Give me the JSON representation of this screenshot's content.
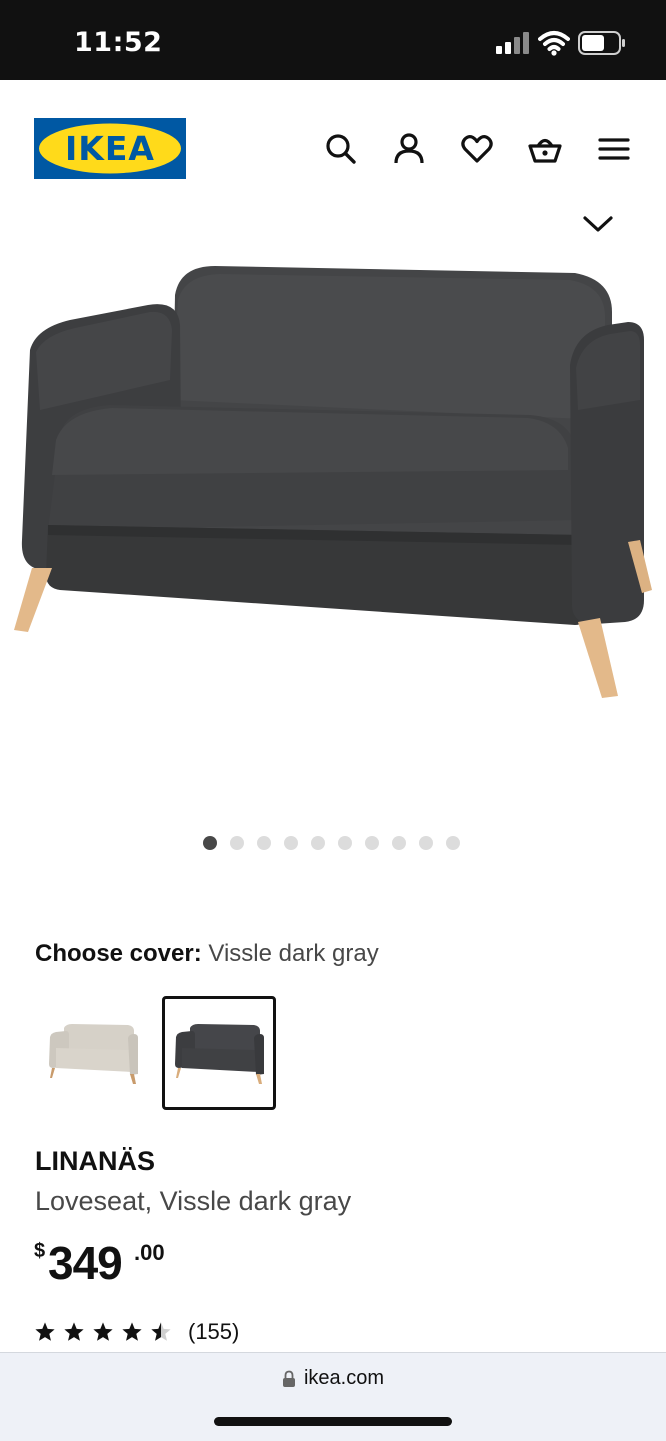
{
  "status_bar": {
    "time": "11:52"
  },
  "header": {
    "logo_text": "IKEA",
    "icons": [
      "search-icon",
      "account-icon",
      "heart-icon",
      "basket-icon",
      "menu-icon"
    ]
  },
  "gallery": {
    "image_count": 10,
    "active_index": 0
  },
  "cover": {
    "label": "Choose cover:",
    "selected_value": "Vissle dark gray",
    "options": [
      {
        "color": "#d6d1c8",
        "selected": false
      },
      {
        "color": "#3e3f41",
        "selected": true
      }
    ]
  },
  "product": {
    "name": "LINANÄS",
    "description": "Loveseat, Vissle dark gray",
    "price": {
      "currency": "$",
      "whole": "349",
      "cents": ".00"
    },
    "rating": {
      "value": 4.5,
      "max": 5,
      "count": "(155)"
    }
  },
  "browser": {
    "url": "ikea.com"
  },
  "colors": {
    "ikea_blue": "#0058a3",
    "ikea_yellow": "#ffda1a",
    "sofa": "#3e3f41",
    "legs": "#e3b98a"
  }
}
